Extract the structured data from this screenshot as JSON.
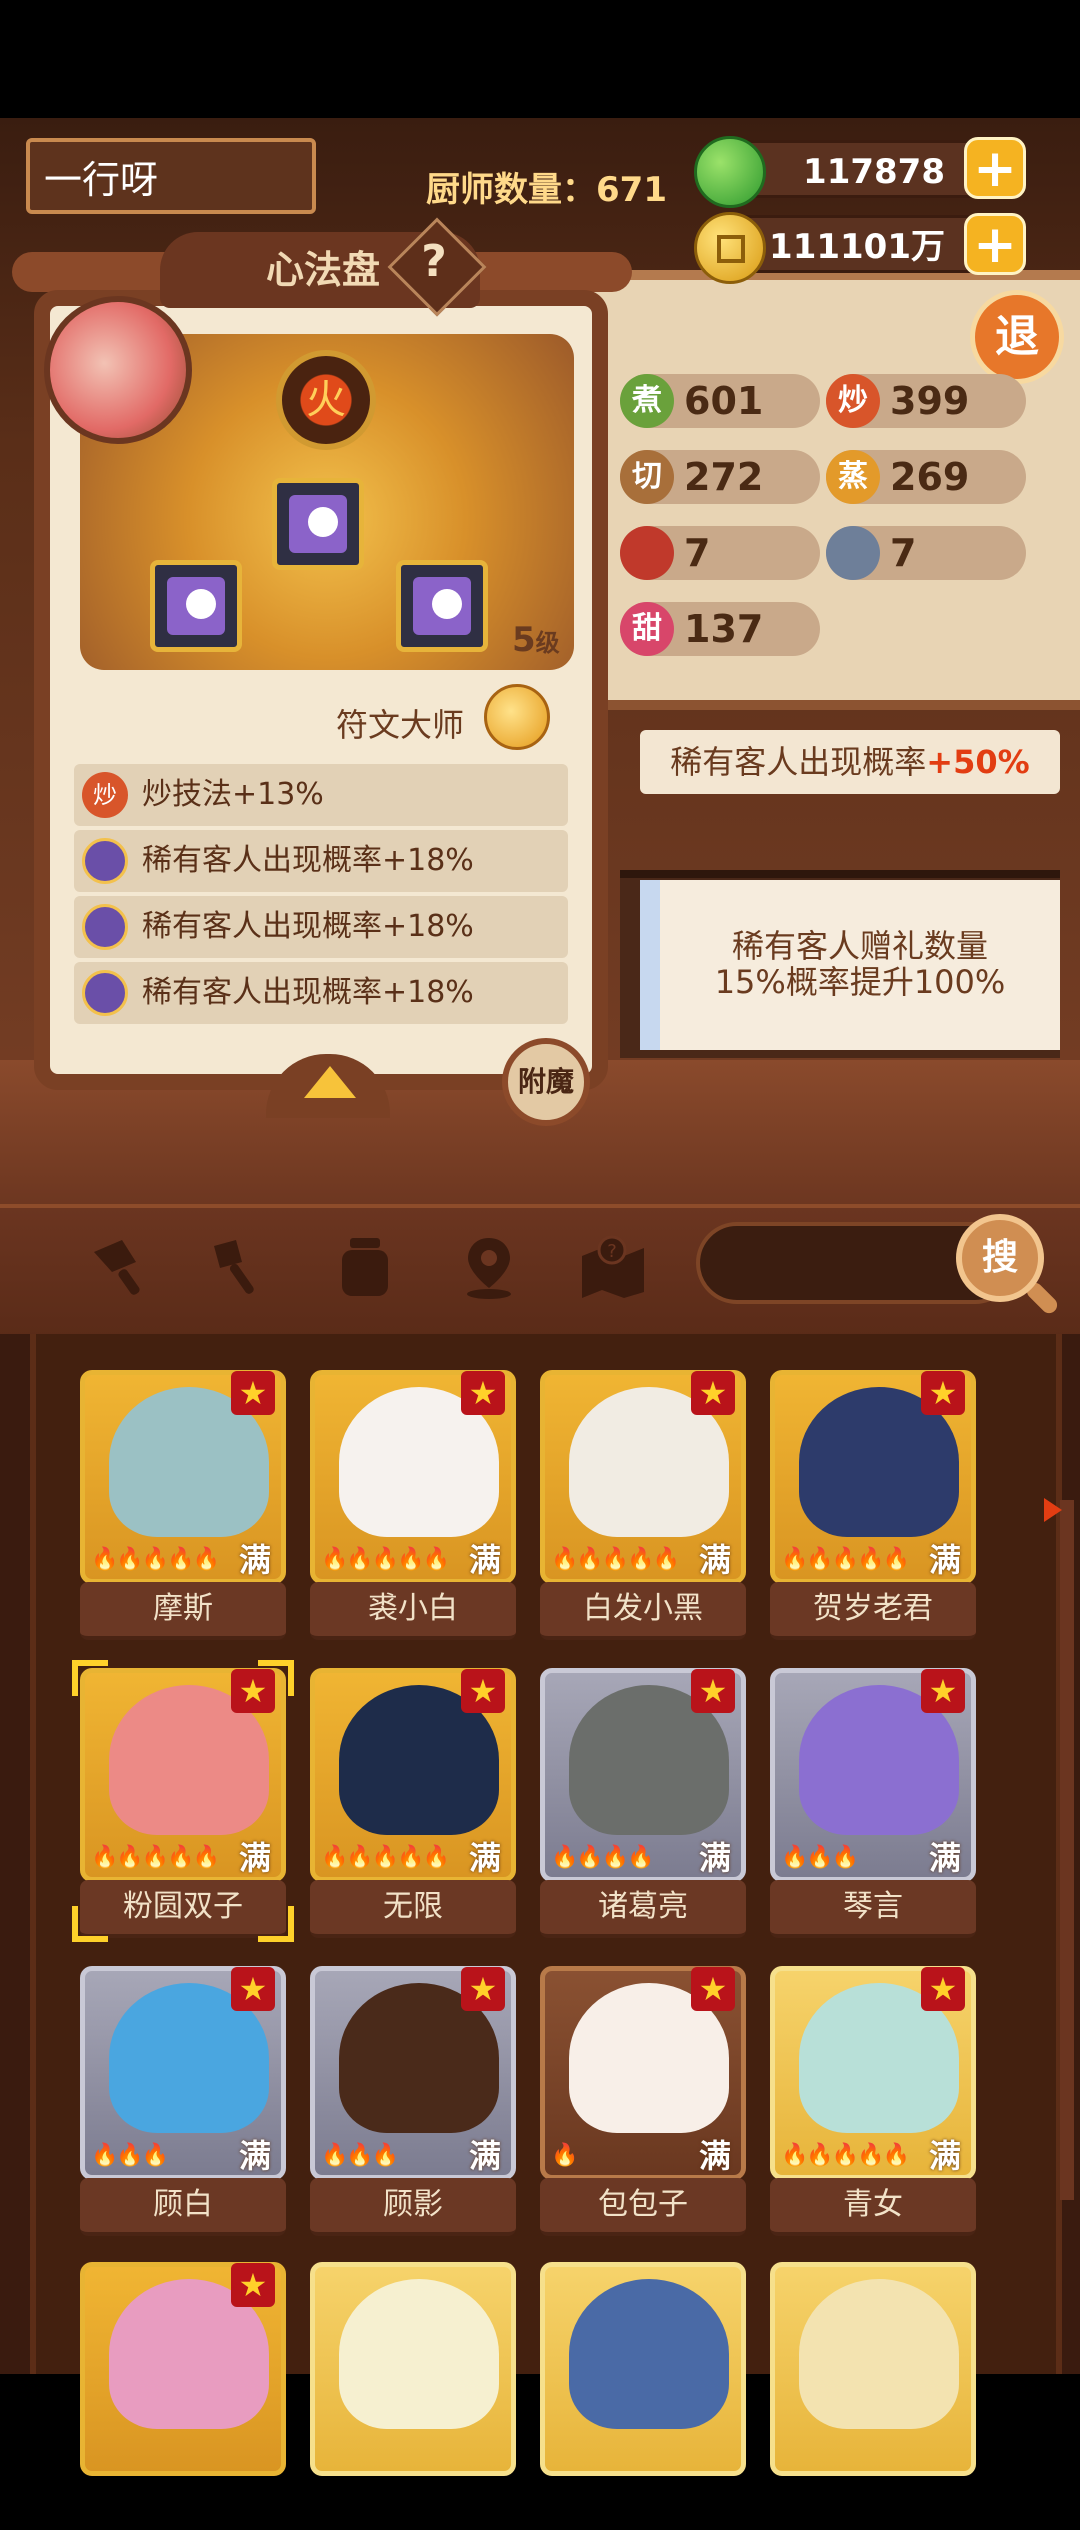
{
  "player": {
    "name": "一行呀"
  },
  "header": {
    "chef_count_label": "厨师数量：671",
    "jade": "117878",
    "coins": "111101万",
    "plus": "+",
    "exit": "退"
  },
  "stats": [
    {
      "icon_label": "煮",
      "value": "601",
      "color": "#6aa13b"
    },
    {
      "icon_label": "炒",
      "value": "399",
      "color": "#d8552a"
    },
    {
      "icon_label": "切",
      "value": "272",
      "color": "#a86f3a"
    },
    {
      "icon_label": "蒸",
      "value": "269",
      "color": "#e39a2a"
    },
    {
      "icon_label": "",
      "value": "7",
      "color": "#c0392b"
    },
    {
      "icon_label": "",
      "value": "7",
      "color": "#6e7f99"
    },
    {
      "icon_label": "甜",
      "value": "137",
      "color": "#d8466a"
    }
  ],
  "bonus_banner": {
    "text": "稀有客人出现概率",
    "value": "+50%"
  },
  "gift_card": {
    "line1": "稀有客人赠礼数量",
    "line2": "15%概率提升100%"
  },
  "panel": {
    "title": "心法盘",
    "help": "?",
    "fire_glyph": "火",
    "level_num": "5",
    "level_unit": "级",
    "rune_title": "符文大师",
    "buffs": [
      {
        "text": "炒技法+13%",
        "icon": "炒"
      },
      {
        "text": "稀有客人出现概率+18%",
        "icon": ""
      },
      {
        "text": "稀有客人出现概率+18%",
        "icon": ""
      },
      {
        "text": "稀有客人出现概率+18%",
        "icon": ""
      }
    ],
    "enchant": "附魔"
  },
  "search": {
    "button": "搜"
  },
  "chefs": [
    {
      "name": "摩斯",
      "tier": "gold",
      "flames": "🔥🔥🔥🔥🔥",
      "full": "满",
      "skin": "#9bc1c4"
    },
    {
      "name": "裘小白",
      "tier": "gold",
      "flames": "🔥🔥🔥🔥🔥",
      "full": "满",
      "skin": "#f6f2ee"
    },
    {
      "name": "白发小黑",
      "tier": "gold",
      "flames": "🔥🔥🔥🔥🔥",
      "full": "满",
      "skin": "#f1ece3"
    },
    {
      "name": "贺岁老君",
      "tier": "gold",
      "flames": "🔥🔥🔥🔥🔥",
      "full": "满",
      "skin": "#2d3b6b"
    },
    {
      "name": "粉圆双子",
      "tier": "gold",
      "flames": "🔥🔥🔥🔥🔥",
      "full": "满",
      "skin": "#ec8a86"
    },
    {
      "name": "无限",
      "tier": "gold",
      "flames": "🔥🔥🔥🔥🔥",
      "full": "满",
      "skin": "#1e2c4a"
    },
    {
      "name": "诸葛亮",
      "tier": "silver",
      "flames": "🔥🔥🔥🔥",
      "full": "满",
      "skin": "#6b6e6b"
    },
    {
      "name": "琴言",
      "tier": "silver",
      "flames": "🔥🔥🔥",
      "full": "满",
      "skin": "#8b6fd1"
    },
    {
      "name": "顾白",
      "tier": "silver",
      "flames": "🔥🔥🔥",
      "full": "满",
      "skin": "#4aa6e0"
    },
    {
      "name": "顾影",
      "tier": "silver",
      "flames": "🔥🔥🔥",
      "full": "满",
      "skin": "#4a2a1a"
    },
    {
      "name": "包包子",
      "tier": "bronze",
      "flames": "🔥",
      "full": "满",
      "skin": "#f8efe8"
    },
    {
      "name": "青女",
      "tier": "lgold",
      "flames": "🔥🔥🔥🔥🔥",
      "full": "满",
      "skin": "#b8e0d8"
    },
    {
      "name": "",
      "tier": "gold",
      "flames": "",
      "full": "",
      "skin": "#e89cc0"
    },
    {
      "name": "",
      "tier": "lgold",
      "flames": "",
      "full": "",
      "skin": "#f6f0d0"
    },
    {
      "name": "",
      "tier": "lgold",
      "flames": "",
      "full": "",
      "skin": "#4a6aa6"
    },
    {
      "name": "",
      "tier": "lgold",
      "flames": "",
      "full": "",
      "skin": "#f3e3b0"
    }
  ]
}
